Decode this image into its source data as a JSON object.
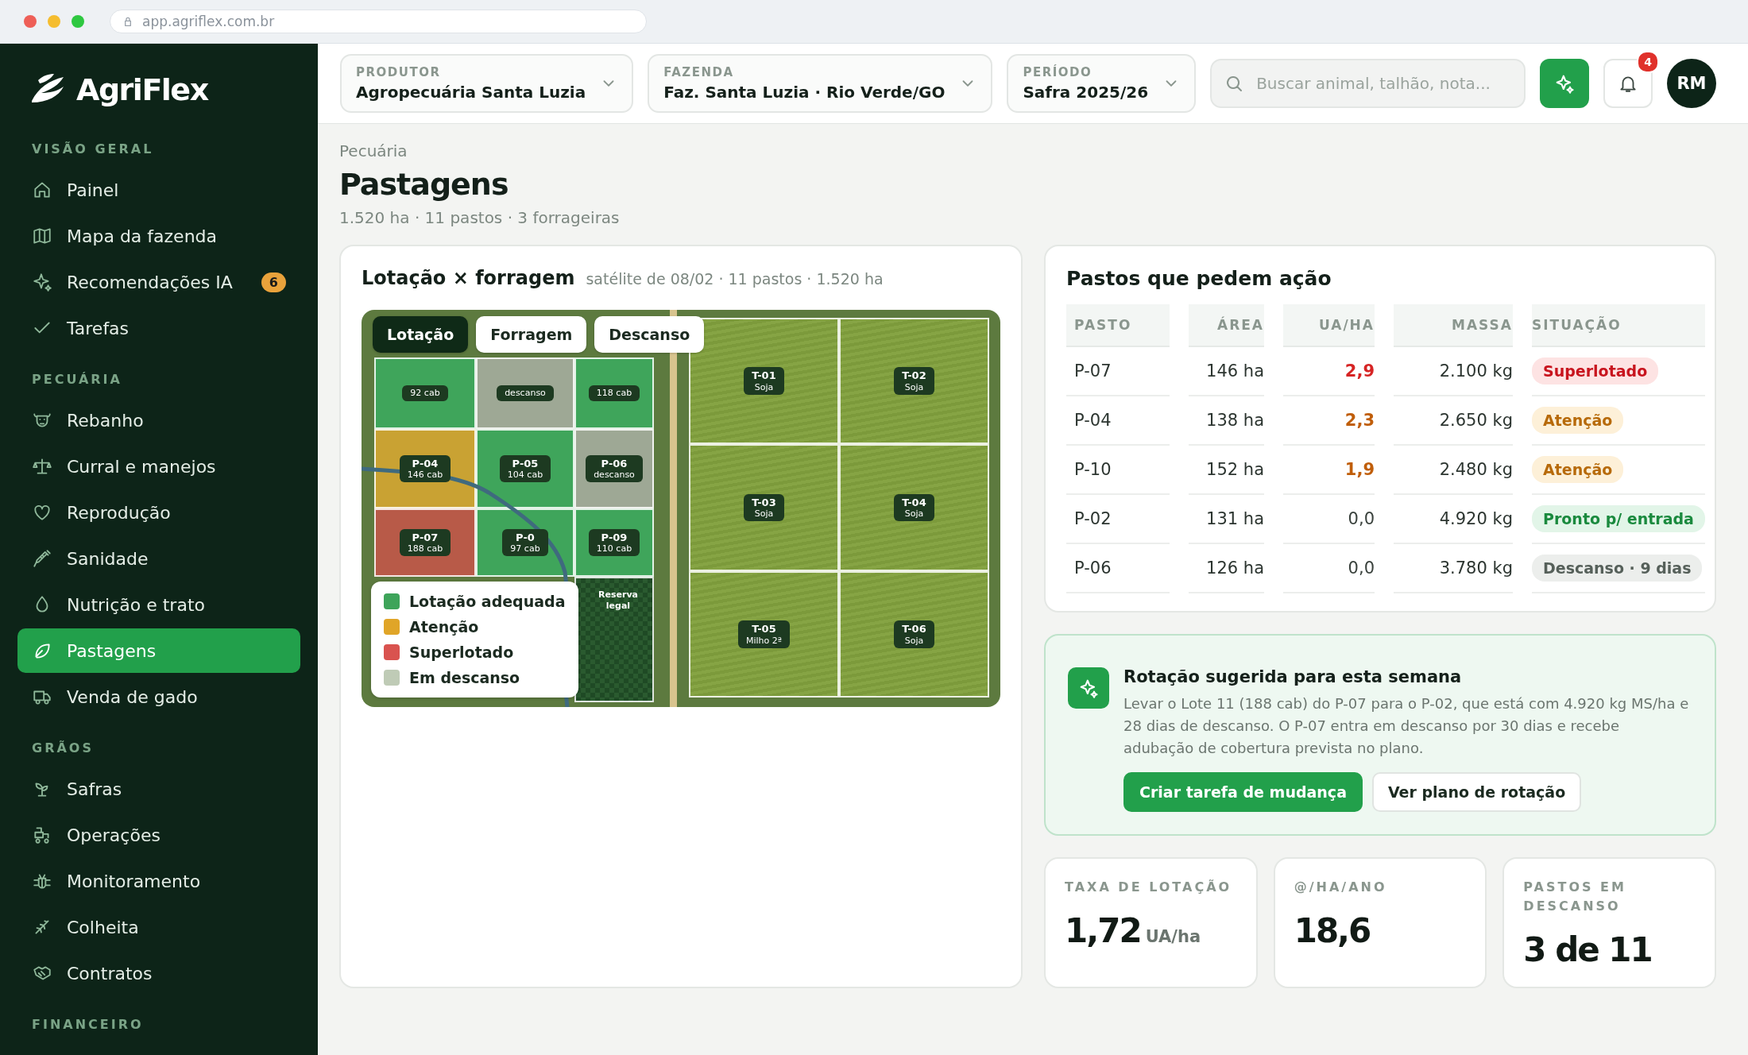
{
  "browser": {
    "url": "app.agriflex.com.br"
  },
  "sidebar": {
    "logo": "AgriFlex",
    "sections": [
      {
        "title": "VISÃO GERAL",
        "items": [
          {
            "label": "Painel",
            "selected": false
          },
          {
            "label": "Mapa da fazenda",
            "selected": false
          },
          {
            "label": "Recomendações IA",
            "selected": false,
            "badge": "6"
          },
          {
            "label": "Tarefas",
            "selected": false
          }
        ]
      },
      {
        "title": "PECUÁRIA",
        "items": [
          {
            "label": "Rebanho",
            "selected": false
          },
          {
            "label": "Curral e manejos",
            "selected": false
          },
          {
            "label": "Reprodução",
            "selected": false
          },
          {
            "label": "Sanidade",
            "selected": false
          },
          {
            "label": "Nutrição e trato",
            "selected": false
          },
          {
            "label": "Pastagens",
            "selected": true
          },
          {
            "label": "Venda de gado",
            "selected": false
          }
        ]
      },
      {
        "title": "GRÃOS",
        "items": [
          {
            "label": "Safras",
            "selected": false
          },
          {
            "label": "Operações",
            "selected": false
          },
          {
            "label": "Monitoramento",
            "selected": false
          },
          {
            "label": "Colheita",
            "selected": false
          },
          {
            "label": "Contratos",
            "selected": false
          }
        ]
      },
      {
        "title": "FINANCEIRO"
      }
    ]
  },
  "topbar": {
    "selectors": [
      {
        "label": "PRODUTOR",
        "value": "Agropecuária Santa Luzia"
      },
      {
        "label": "FAZENDA",
        "value": "Faz. Santa Luzia · Rio Verde/GO"
      },
      {
        "label": "PERÍODO",
        "value": "Safra 2025/26"
      }
    ],
    "search": {
      "placeholder": "Buscar animal, talhão, nota..."
    },
    "notifications": "4",
    "avatar": "RM"
  },
  "page": {
    "breadcrumb": "Pecuária",
    "title": "Pastagens",
    "subtitle": "1.520 ha · 11 pastos · 3 forrageiras"
  },
  "map_card": {
    "title": "Lotação × forragem",
    "meta": "satélite de 08/02 · 11 pastos · 1.520 ha",
    "tabs": [
      {
        "label": "Lotação",
        "selected": true
      },
      {
        "label": "Forragem",
        "selected": false
      },
      {
        "label": "Descanso",
        "selected": false
      }
    ],
    "pastures": [
      {
        "kind": "pasture",
        "detail": "92 cab",
        "color": "#3fa55b"
      },
      {
        "kind": "pasture",
        "detail": "descanso",
        "color": "#9ea895"
      },
      {
        "kind": "pasture",
        "detail": "118 cab",
        "color": "#3fa55b"
      },
      {
        "kind": "pasture",
        "name": "P-04",
        "detail": "146 cab",
        "color": "#c9a233"
      },
      {
        "kind": "pasture",
        "name": "P-05",
        "detail": "104 cab",
        "color": "#3fa55b"
      },
      {
        "kind": "pasture",
        "name": "P-06",
        "detail": "descanso",
        "color": "#9ea895"
      },
      {
        "kind": "pasture",
        "name": "P-07",
        "detail": "188 cab",
        "color": "#b85a48"
      },
      {
        "kind": "pasture",
        "name": "P-0",
        "detail": "97 cab",
        "color": "#3fa55b"
      },
      {
        "kind": "pasture",
        "name": "P-09",
        "detail": "110 cab",
        "color": "#3fa55b"
      },
      {
        "kind": "reserve",
        "name": "Reserva legal"
      }
    ],
    "fields": [
      {
        "name": "T-01",
        "crop": "Soja"
      },
      {
        "name": "T-02",
        "crop": "Soja"
      },
      {
        "name": "T-03",
        "crop": "Soja"
      },
      {
        "name": "T-04",
        "crop": "Soja"
      },
      {
        "name": "T-05",
        "crop": "Milho 2ª"
      },
      {
        "name": "T-06",
        "crop": "Soja"
      }
    ],
    "legend": [
      {
        "label": "Lotação adequada",
        "color": "#3ea45a"
      },
      {
        "label": "Atenção",
        "color": "#e0a528"
      },
      {
        "label": "Superlotado",
        "color": "#d9534f"
      },
      {
        "label": "Em descanso",
        "color": "#bfcbb6"
      }
    ]
  },
  "actions_card": {
    "title": "Pastos que pedem ação",
    "columns": [
      "PASTO",
      "ÁREA",
      "UA/HA",
      "MASSA",
      "SITUAÇÃO"
    ],
    "rows": [
      {
        "pasture": "P-07",
        "area": "146 ha",
        "ua": "2,9",
        "mass": "2.100 kg",
        "status": "Superlotado",
        "kind": "overloaded"
      },
      {
        "pasture": "P-04",
        "area": "138 ha",
        "ua": "2,3",
        "mass": "2.650 kg",
        "status": "Atenção",
        "kind": "attention"
      },
      {
        "pasture": "P-10",
        "area": "152 ha",
        "ua": "1,9",
        "mass": "2.480 kg",
        "status": "Atenção",
        "kind": "attention"
      },
      {
        "pasture": "P-02",
        "area": "131 ha",
        "ua": "0,0",
        "mass": "4.920 kg",
        "status": "Pronto p/ entrada",
        "kind": "ready"
      },
      {
        "pasture": "P-06",
        "area": "126 ha",
        "ua": "0,0",
        "mass": "3.780 kg",
        "status": "Descanso · 9 dias",
        "kind": "resting"
      }
    ]
  },
  "suggestion": {
    "title": "Rotação sugerida para esta semana",
    "text": "Levar o Lote 11 (188 cab) do P-07 para o P-02, que está com 4.920 kg MS/ha e 28 dias de descanso. O P-07 entra em descanso por 30 dias e recebe adubação de cobertura prevista no plano.",
    "buttons": [
      {
        "label": "Criar tarefa de mudança",
        "kind": "primary"
      },
      {
        "label": "Ver plano de rotação",
        "kind": "secondary"
      }
    ]
  },
  "kpis": [
    {
      "label": "TAXA DE LOTAÇÃO",
      "value": "1,72",
      "unit": "UA/ha"
    },
    {
      "label": "@/HA/ANO",
      "value": "18,6"
    },
    {
      "label": "PASTOS EM DESCANSO",
      "value": "3 de 11"
    }
  ]
}
